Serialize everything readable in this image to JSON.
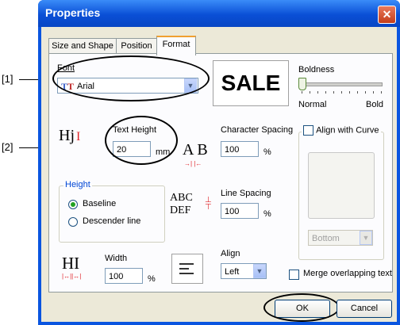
{
  "window": {
    "title": "Properties",
    "close_glyph": "✕"
  },
  "tabs": [
    {
      "label": "Size and Shape"
    },
    {
      "label": "Position"
    },
    {
      "label": "Format"
    }
  ],
  "callouts": [
    {
      "label": "[1]"
    },
    {
      "label": "[2]"
    }
  ],
  "font": {
    "label": "Font",
    "value": "Arial",
    "preview": "SALE"
  },
  "boldness": {
    "label": "Boldness",
    "min_label": "Normal",
    "max_label": "Bold",
    "level": 0
  },
  "text_height": {
    "label": "Text Height",
    "value": "20",
    "unit": "mm",
    "icon_text": "Hj"
  },
  "character_spacing": {
    "label": "Character Spacing",
    "value": "100",
    "unit": "%",
    "icon_text": "A B"
  },
  "align_with_curve": {
    "label": "Align with Curve",
    "checked": false,
    "position_value": "Bottom"
  },
  "height_group": {
    "label": "Height",
    "options": [
      {
        "label": "Baseline",
        "selected": true
      },
      {
        "label": "Descender line",
        "selected": false
      }
    ]
  },
  "line_spacing": {
    "label": "Line Spacing",
    "value": "100",
    "unit": "%",
    "icon_line1": "ABC",
    "icon_line2": "DEF"
  },
  "width": {
    "label": "Width",
    "value": "100",
    "unit": "%",
    "icon_text": "HI"
  },
  "align": {
    "label": "Align",
    "value": "Left"
  },
  "merge_overlapping": {
    "label": "Merge overlapping text",
    "checked": false
  },
  "buttons": {
    "ok": "OK",
    "cancel": "Cancel"
  }
}
